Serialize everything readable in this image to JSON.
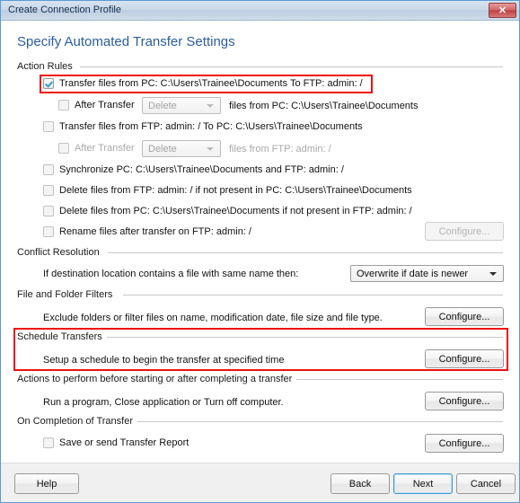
{
  "window": {
    "title": "Create Connection Profile",
    "close_label": "✕"
  },
  "heading": "Specify Automated Transfer Settings",
  "groups": {
    "action_rules": "Action Rules",
    "conflict_resolution": "Conflict Resolution",
    "file_folder_filters": "File and Folder Filters",
    "schedule_transfers": "Schedule Transfers",
    "actions_before_after": "Actions to perform before starting or after completing a transfer",
    "on_completion": "On Completion of Transfer"
  },
  "action_rules": {
    "row1": {
      "label": "Transfer files from PC: C:\\Users\\Trainee\\Documents  To  FTP: admin: /",
      "checked": true
    },
    "row1_sub": {
      "label": "After Transfer",
      "combo_value": "Delete",
      "trailing": "files from PC: C:\\Users\\Trainee\\Documents",
      "checked": false
    },
    "row2": {
      "label": "Transfer files from FTP: admin: /  To  PC: C:\\Users\\Trainee\\Documents",
      "checked": false
    },
    "row2_sub": {
      "label": "After Transfer",
      "combo_value": "Delete",
      "trailing": "files from FTP: admin: /",
      "checked": false
    },
    "row3": {
      "label": "Synchronize PC: C:\\Users\\Trainee\\Documents and FTP: admin: /",
      "checked": false
    },
    "row4": {
      "label": "Delete files from FTP: admin: / if not present in PC: C:\\Users\\Trainee\\Documents",
      "checked": false
    },
    "row5": {
      "label": "Delete files from PC: C:\\Users\\Trainee\\Documents if not present in FTP: admin: /",
      "checked": false
    },
    "row6": {
      "label": "Rename files after transfer on FTP: admin: /",
      "checked": false,
      "configure_label": "Configure..."
    }
  },
  "conflict_resolution": {
    "prompt": "If destination location contains a file with same name then:",
    "selected": "Overwrite if date is newer"
  },
  "file_folder_filters": {
    "description": "Exclude folders or filter files on name, modification date, file size and file type.",
    "configure_label": "Configure..."
  },
  "schedule_transfers": {
    "description": "Setup a schedule to begin the transfer at specified time",
    "configure_label": "Configure..."
  },
  "actions_before_after": {
    "description": "Run a program, Close application or Turn off computer.",
    "configure_label": "Configure..."
  },
  "on_completion": {
    "checkbox_label": "Save or send Transfer Report",
    "checked": false,
    "configure_label": "Configure..."
  },
  "footer": {
    "help": "Help",
    "back": "Back",
    "next": "Next",
    "cancel": "Cancel"
  },
  "colors": {
    "heading": "#2a5d9e",
    "annotation": "#ee1111",
    "title_bar": "#cbd9e8",
    "check_mark": "#2f9fd0",
    "focus_border": "#3c99d4"
  }
}
